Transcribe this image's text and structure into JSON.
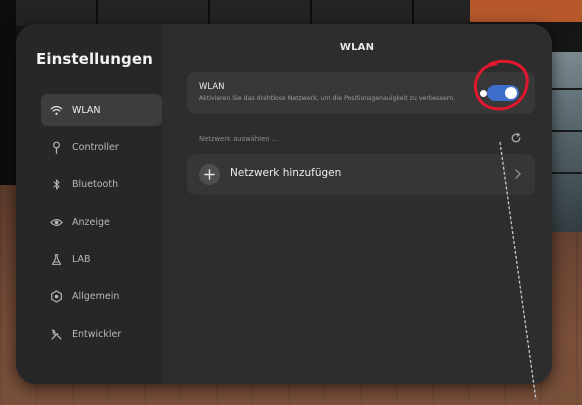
{
  "app": {
    "title": "Einstellungen"
  },
  "sidebar": {
    "items": [
      {
        "label": "WLAN",
        "icon": "wifi-icon",
        "active": true
      },
      {
        "label": "Controller",
        "icon": "controller-icon",
        "active": false
      },
      {
        "label": "Bluetooth",
        "icon": "bluetooth-icon",
        "active": false
      },
      {
        "label": "Anzeige",
        "icon": "eye-icon",
        "active": false
      },
      {
        "label": "LAB",
        "icon": "flask-icon",
        "active": false
      },
      {
        "label": "Allgemein",
        "icon": "gear-icon",
        "active": false
      },
      {
        "label": "Entwickler",
        "icon": "tools-icon",
        "active": false
      }
    ]
  },
  "main": {
    "title": "WLAN",
    "wlan_card": {
      "title": "WLAN",
      "description": "Aktivieren Sie das drahtlose Netzwerk, um die Positionsgenauigkeit zu verbessern.",
      "toggle_on": true
    },
    "network_select_label": "Netzwerk auswählen ...",
    "refresh_icon": "refresh-icon",
    "add_network": {
      "label": "Netzwerk hinzufügen",
      "icon": "plus-icon",
      "chevron": "chevron-right-icon"
    }
  },
  "colors": {
    "accent": "#3d6ec9",
    "annotation": "#e0182d",
    "panel": "#2d2d2d",
    "sidebar": "#272727"
  }
}
